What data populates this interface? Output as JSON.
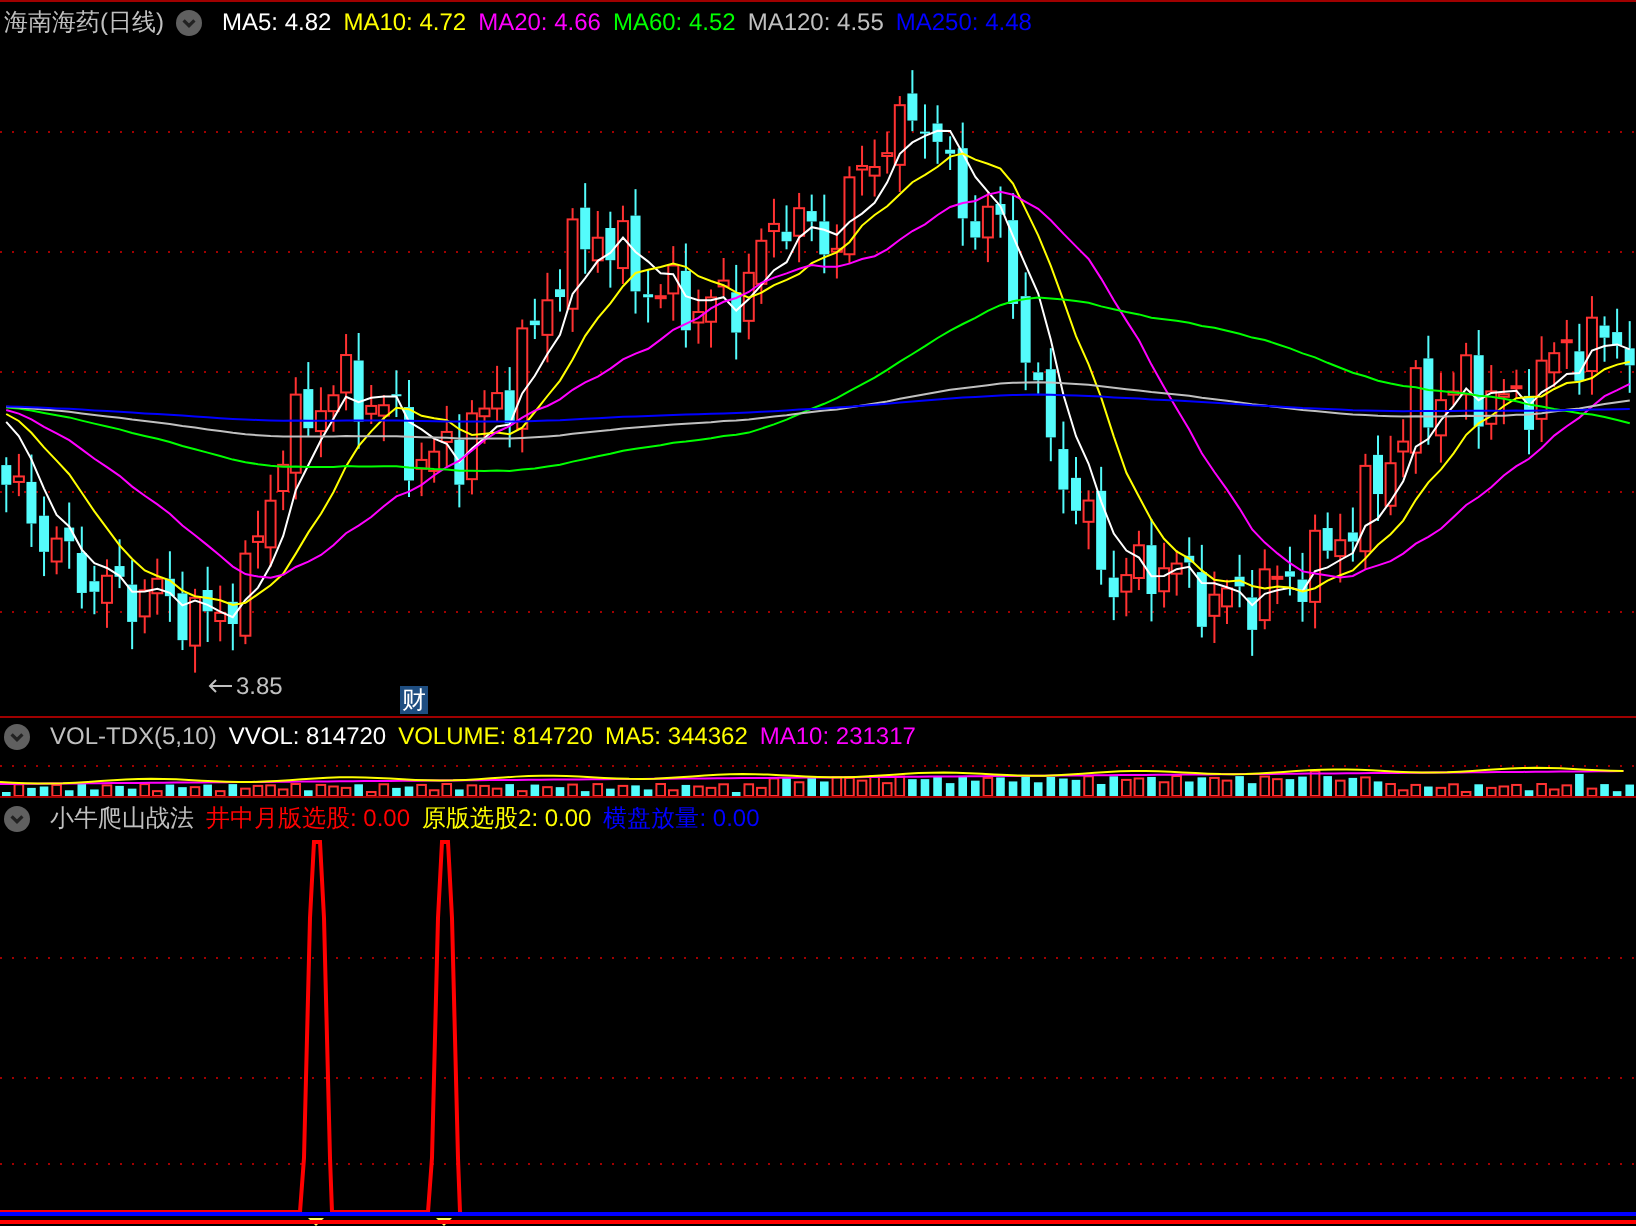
{
  "price_panel": {
    "title": "海南海药(日线)",
    "indicators": [
      {
        "text": "MA5: 4.82",
        "color": "#ffffff"
      },
      {
        "text": "MA10: 4.72",
        "color": "#ffff00"
      },
      {
        "text": "MA20: 4.66",
        "color": "#ff00ff"
      },
      {
        "text": "MA60: 4.52",
        "color": "#00ff00"
      },
      {
        "text": "MA120: 4.55",
        "color": "#c0c0c0"
      },
      {
        "text": "MA250: 4.48",
        "color": "#0000ff"
      }
    ],
    "low_label": "3.85",
    "finance_badge": "财"
  },
  "volume_panel": {
    "title": "VOL-TDX(5,10)",
    "indicators": [
      {
        "text": "VVOL: 814720",
        "color": "#ffffff"
      },
      {
        "text": "VOLUME: 814720",
        "color": "#ffff00"
      },
      {
        "text": "MA5: 344362",
        "color": "#ffff00"
      },
      {
        "text": "MA10: 231317",
        "color": "#ff00ff"
      }
    ]
  },
  "signal_panel": {
    "title": "小牛爬山战法",
    "indicators": [
      {
        "text": "井中月版选股: 0.00",
        "color": "#ff0000"
      },
      {
        "text": "原版选股2: 0.00",
        "color": "#ffff00"
      },
      {
        "text": "横盘放量: 0.00",
        "color": "#0000ff"
      }
    ]
  }
}
